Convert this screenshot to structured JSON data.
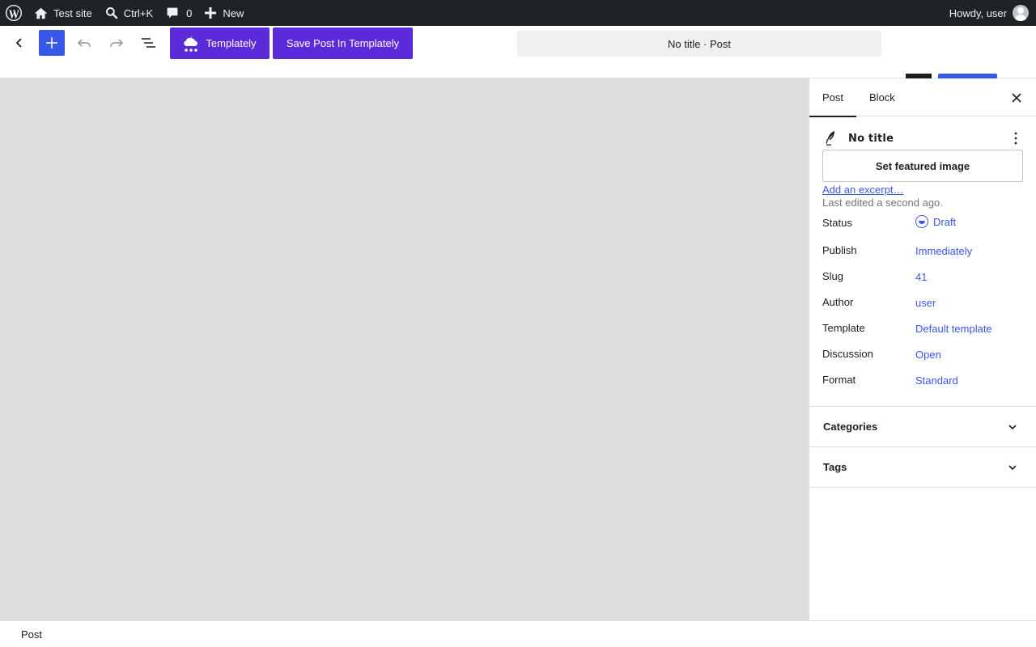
{
  "adminbar": {
    "site_name": "Test site",
    "search_shortcut": "Ctrl+K",
    "comments_count": "0",
    "new_label": "New",
    "greeting": "Howdy, user"
  },
  "header": {
    "templately_label": "Templately",
    "save_templately_label": "Save Post In Templately",
    "document_title": "No title · Post"
  },
  "sidebar": {
    "tabs": [
      {
        "label": "Post",
        "active": true
      },
      {
        "label": "Block",
        "active": false
      }
    ],
    "post_title": "No title",
    "featured_image_label": "Set featured image",
    "excerpt_link": "Add an excerpt…",
    "last_edited": "Last edited a second ago.",
    "meta": [
      {
        "label": "Status",
        "value": "Draft"
      },
      {
        "label": "Publish",
        "value": "Immediately"
      },
      {
        "label": "Slug",
        "value": "41"
      },
      {
        "label": "Author",
        "value": "user"
      },
      {
        "label": "Template",
        "value": "Default template"
      },
      {
        "label": "Discussion",
        "value": "Open"
      },
      {
        "label": "Format",
        "value": "Standard"
      }
    ],
    "panels": [
      {
        "title": "Categories",
        "expanded": false
      },
      {
        "title": "Tags",
        "expanded": false
      }
    ]
  },
  "footer": {
    "breadcrumb": "Post"
  },
  "colors": {
    "accent": "#3858e9",
    "templately": "#5b2bd9",
    "adminbar": "#1d2327",
    "canvas": "#dddddd"
  }
}
